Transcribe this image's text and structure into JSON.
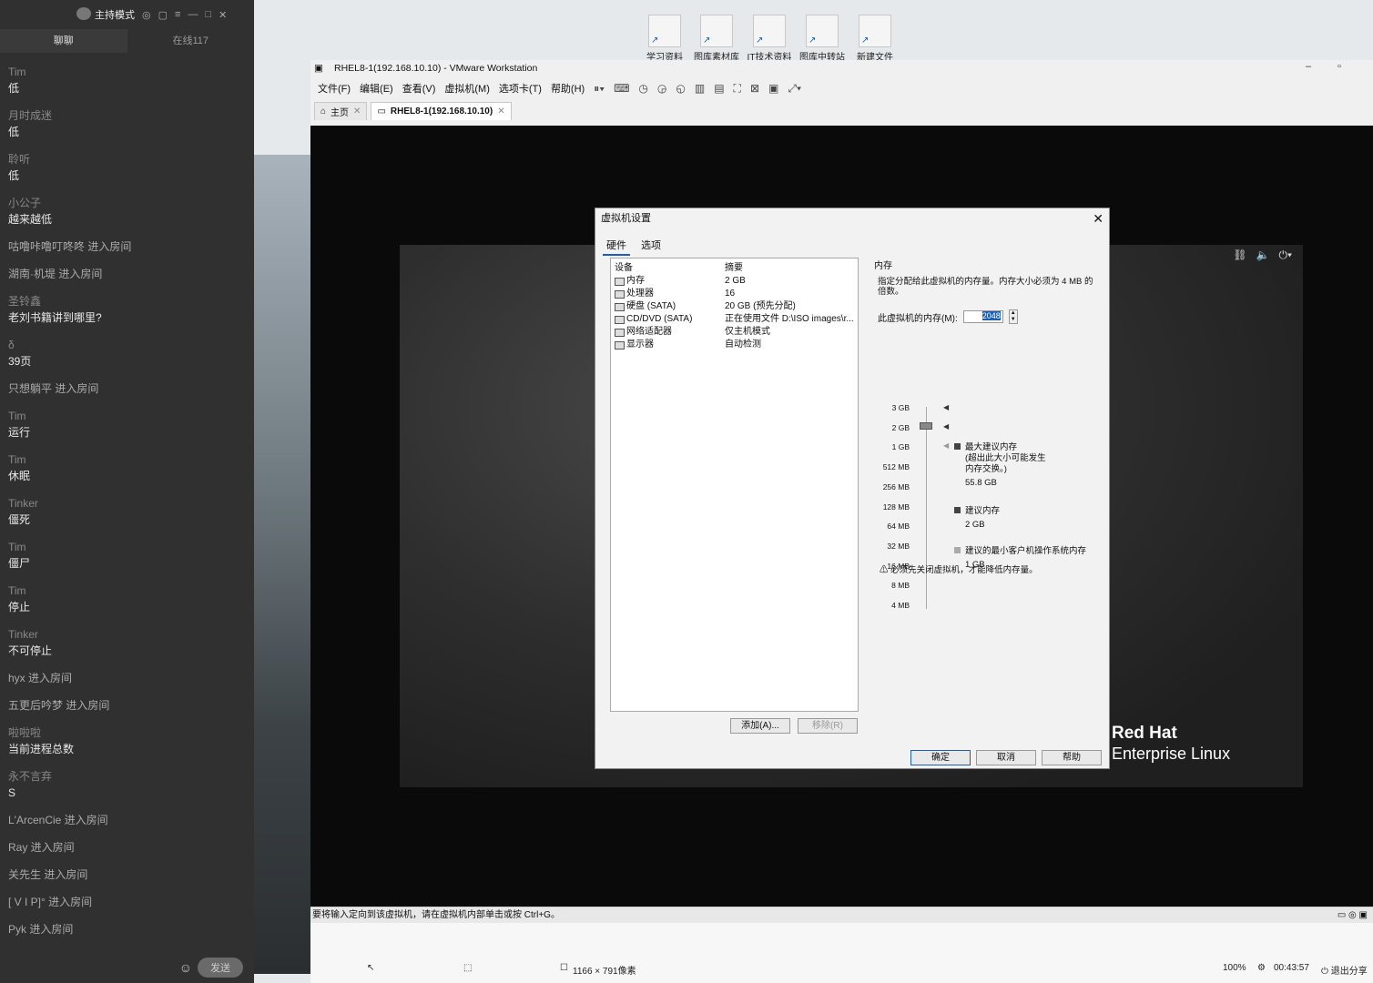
{
  "chat": {
    "mode_label": "主持模式",
    "tabs": [
      "聊聊",
      "在线117"
    ],
    "messages": [
      {
        "user": "Tim",
        "text": "低"
      },
      {
        "user": "月时成迷",
        "text": "低"
      },
      {
        "user": "聆听",
        "text": "低"
      },
      {
        "user": "小公子",
        "text": "越来越低"
      },
      {
        "user": "",
        "text": "咕噜咔噜叮咚咚 进入房间"
      },
      {
        "user": "",
        "text": "湖南·机堤 进入房间"
      },
      {
        "user": "圣铃鑫",
        "text": "老刘书籍讲到哪里?"
      },
      {
        "user": "δ",
        "text": "39页"
      },
      {
        "user": "",
        "text": "只想躺平 进入房间"
      },
      {
        "user": "Tim",
        "text": "运行"
      },
      {
        "user": "Tim",
        "text": "休眠"
      },
      {
        "user": "Tinker",
        "text": "僵死"
      },
      {
        "user": "Tim",
        "text": "僵尸"
      },
      {
        "user": "Tim",
        "text": "停止"
      },
      {
        "user": "Tinker",
        "text": "不可停止"
      },
      {
        "user": "",
        "text": "hyx 进入房间"
      },
      {
        "user": "",
        "text": "五更后吟梦 进入房间"
      },
      {
        "user": "啦啦啦",
        "text": "当前进程总数"
      },
      {
        "user": "永不言弃",
        "text": "S"
      },
      {
        "user": "",
        "text": "L'ArcenCie 进入房间"
      },
      {
        "user": "",
        "text": "Ray 进入房间"
      },
      {
        "user": "",
        "text": "关先生 进入房间"
      },
      {
        "user": "",
        "text": "[ V I P]° 进入房间"
      },
      {
        "user": "",
        "text": "Pyk 进入房间"
      }
    ],
    "send_label": "发送"
  },
  "desktop_icons": [
    "学习资料",
    "图库素材库",
    "IT技术资料",
    "图库中转站",
    "新建文件"
  ],
  "vmware": {
    "title": "RHEL8-1(192.168.10.10) - VMware Workstation",
    "menus": [
      "文件(F)",
      "编辑(E)",
      "查看(V)",
      "虚拟机(M)",
      "选项卡(T)",
      "帮助(H)"
    ],
    "tabs": [
      {
        "label": "主页"
      },
      {
        "label": "RHEL8-1(192.168.10.10)"
      }
    ],
    "guest_brand_line1": "Red Hat",
    "guest_brand_line2": "Enterprise Linux",
    "status_text": "要将输入定向到该虚拟机，请在虚拟机内部单击或按 Ctrl+G。",
    "bottom_resolution": "1166 × 791像素",
    "bottom_zoom": "100%",
    "bottom_time": "00:43:57",
    "bottom_exit": "退出分享"
  },
  "dialog": {
    "title": "虚拟机设置",
    "tabs": [
      "硬件",
      "选项"
    ],
    "col_device": "设备",
    "col_summary": "摘要",
    "devices": [
      {
        "name": "内存",
        "summary": "2 GB",
        "icon": "memory-icon"
      },
      {
        "name": "处理器",
        "summary": "16",
        "icon": "processor-icon"
      },
      {
        "name": "硬盘 (SATA)",
        "summary": "20 GB (预先分配)",
        "icon": "harddisk-icon"
      },
      {
        "name": "CD/DVD (SATA)",
        "summary": "正在使用文件 D:\\ISO images\\r...",
        "icon": "cdrom-icon"
      },
      {
        "name": "网络适配器",
        "summary": "仅主机模式",
        "icon": "network-icon"
      },
      {
        "name": "显示器",
        "summary": "自动检测",
        "icon": "display-icon"
      }
    ],
    "add_label": "添加(A)...",
    "remove_label": "移除(R)",
    "ok_label": "确定",
    "cancel_label": "取消",
    "help_label": "帮助",
    "memory": {
      "group_label": "内存",
      "description": "指定分配给此虚拟机的内存量。内存大小必须为 4 MB 的倍数。",
      "field_label": "此虚拟机的内存(M):",
      "value": "2048",
      "scale": [
        "3 GB",
        "2 GB",
        "1 GB",
        "512 MB",
        "256 MB",
        "128 MB",
        "64 MB",
        "32 MB",
        "16 MB",
        "8 MB",
        "4 MB"
      ],
      "legend": [
        {
          "label": "最大建议内存",
          "note": "(超出此大小可能发生内存交换。)",
          "value": "55.8 GB",
          "color": "#444444"
        },
        {
          "label": "建议内存",
          "note": "",
          "value": "2 GB",
          "color": "#444444"
        },
        {
          "label": "建议的最小客户机操作系统内存",
          "note": "",
          "value": "1 GB",
          "color": "#aaaaaa"
        }
      ],
      "warning": "必须先关闭虚拟机，才能降低内存量。"
    }
  }
}
